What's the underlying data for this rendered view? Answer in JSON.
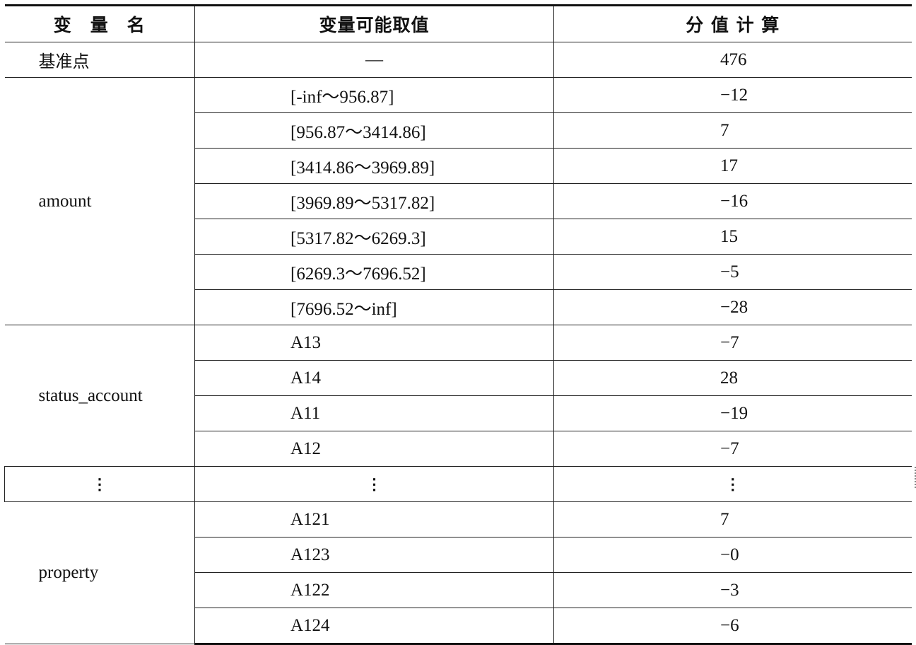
{
  "table": {
    "headers": {
      "variable": "变　量　名",
      "range": "变量可能取值",
      "score": "分 值 计 算"
    },
    "base": {
      "label": "基准点",
      "range": "—",
      "score": "476"
    },
    "groups": [
      {
        "variable": "amount",
        "rows": [
          {
            "range": "[-inf～956.87]",
            "score": "−12"
          },
          {
            "range": "[956.87～3414.86]",
            "score": "7"
          },
          {
            "range": "[3414.86～3969.89]",
            "score": "17"
          },
          {
            "range": "[3969.89～5317.82]",
            "score": "−16"
          },
          {
            "range": "[5317.82～6269.3]",
            "score": "15"
          },
          {
            "range": "[6269.3～7696.52]",
            "score": "−5"
          },
          {
            "range": "[7696.52～inf]",
            "score": "−28"
          }
        ]
      },
      {
        "variable": "status_account",
        "rows": [
          {
            "range": "A13",
            "score": "−7"
          },
          {
            "range": "A14",
            "score": "28"
          },
          {
            "range": "A11",
            "score": "−19"
          },
          {
            "range": "A12",
            "score": "−7"
          }
        ]
      },
      {
        "variable": "property",
        "rows": [
          {
            "range": "A121",
            "score": "7"
          },
          {
            "range": "A123",
            "score": "−0"
          },
          {
            "range": "A122",
            "score": "−3"
          },
          {
            "range": "A124",
            "score": "−6"
          }
        ]
      }
    ],
    "ellipsis": "⋮"
  }
}
